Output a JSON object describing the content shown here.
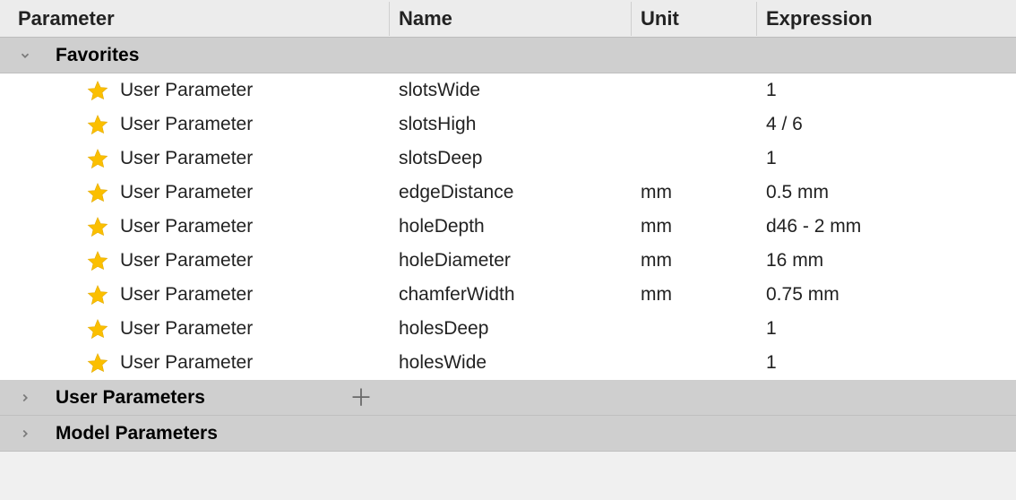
{
  "columns": {
    "parameter": "Parameter",
    "name": "Name",
    "unit": "Unit",
    "expression": "Expression"
  },
  "groups": {
    "favorites": {
      "label": "Favorites",
      "expanded": true
    },
    "user_parameters": {
      "label": "User Parameters",
      "expanded": false,
      "showAdd": true
    },
    "model_parameters": {
      "label": "Model Parameters",
      "expanded": false
    }
  },
  "rowType": "User Parameter",
  "favoriteRows": [
    {
      "name": "slotsWide",
      "unit": "",
      "expression": "1"
    },
    {
      "name": "slotsHigh",
      "unit": "",
      "expression": "4 / 6"
    },
    {
      "name": "slotsDeep",
      "unit": "",
      "expression": "1"
    },
    {
      "name": "edgeDistance",
      "unit": "mm",
      "expression": "0.5 mm"
    },
    {
      "name": "holeDepth",
      "unit": "mm",
      "expression": "d46 - 2 mm"
    },
    {
      "name": "holeDiameter",
      "unit": "mm",
      "expression": "16 mm"
    },
    {
      "name": "chamferWidth",
      "unit": "mm",
      "expression": "0.75 mm"
    },
    {
      "name": "holesDeep",
      "unit": "",
      "expression": "1"
    },
    {
      "name": "holesWide",
      "unit": "",
      "expression": "1"
    }
  ]
}
